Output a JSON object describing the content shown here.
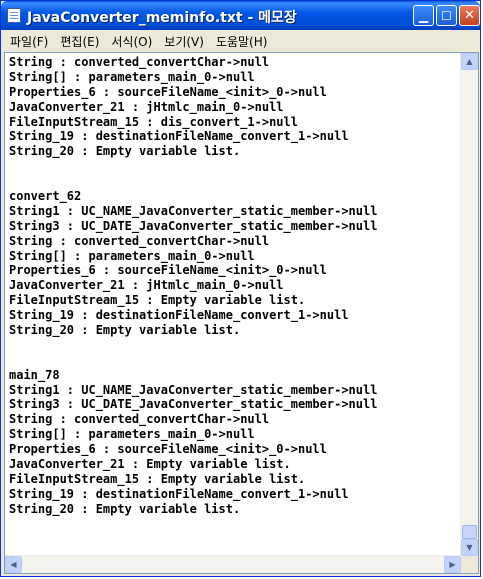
{
  "window": {
    "title": "JavaConverter_meminfo.txt - 메모장"
  },
  "menu": [
    "파일(F)",
    "편집(E)",
    "서식(O)",
    "보기(V)",
    "도움말(H)"
  ],
  "lines": [
    "String : converted_convertChar->null",
    "String[] : parameters_main_0->null",
    "Properties_6 : sourceFileName_<init>_0->null",
    "JavaConverter_21 : jHtmlc_main_0->null",
    "FileInputStream_15 : dis_convert_1->null",
    "String_19 : destinationFileName_convert_1->null",
    "String_20 : Empty variable list.",
    "",
    "",
    "convert_62",
    "String1 : UC_NAME_JavaConverter_static_member->null",
    "String3 : UC_DATE_JavaConverter_static_member->null",
    "String : converted_convertChar->null",
    "String[] : parameters_main_0->null",
    "Properties_6 : sourceFileName_<init>_0->null",
    "JavaConverter_21 : jHtmlc_main_0->null",
    "FileInputStream_15 : Empty variable list.",
    "String_19 : destinationFileName_convert_1->null",
    "String_20 : Empty variable list.",
    "",
    "",
    "main_78",
    "String1 : UC_NAME_JavaConverter_static_member->null",
    "String3 : UC_DATE_JavaConverter_static_member->null",
    "String : converted_convertChar->null",
    "String[] : parameters_main_0->null",
    "Properties_6 : sourceFileName_<init>_0->null",
    "JavaConverter_21 : Empty variable list.",
    "FileInputStream_15 : Empty variable list.",
    "String_19 : destinationFileName_convert_1->null",
    "String_20 : Empty variable list."
  ],
  "icons": {
    "app": "notepad-icon",
    "minimize": "minimize-icon",
    "maximize": "maximize-icon",
    "close": "close-icon",
    "scroll_up": "scroll-up-arrow-icon",
    "scroll_down": "scroll-down-arrow-icon",
    "scroll_left": "scroll-left-arrow-icon",
    "scroll_right": "scroll-right-arrow-icon"
  },
  "colors": {
    "titlebar": "#0058e6",
    "close_button": "#c2421e",
    "text": "#000000",
    "background": "#ffffff"
  }
}
